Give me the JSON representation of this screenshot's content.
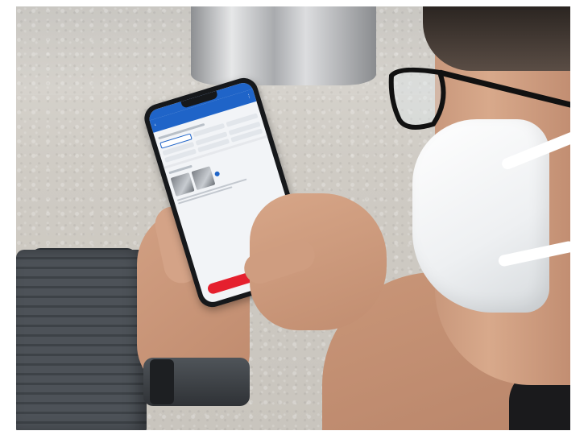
{
  "phone_app": {
    "navbar": {
      "back_icon": "chevron-left-icon",
      "more_icon": "more-icon"
    },
    "form_options_selected_index": 0,
    "submit_button_color": "#e5202e",
    "header_color": "#1f64c8"
  }
}
